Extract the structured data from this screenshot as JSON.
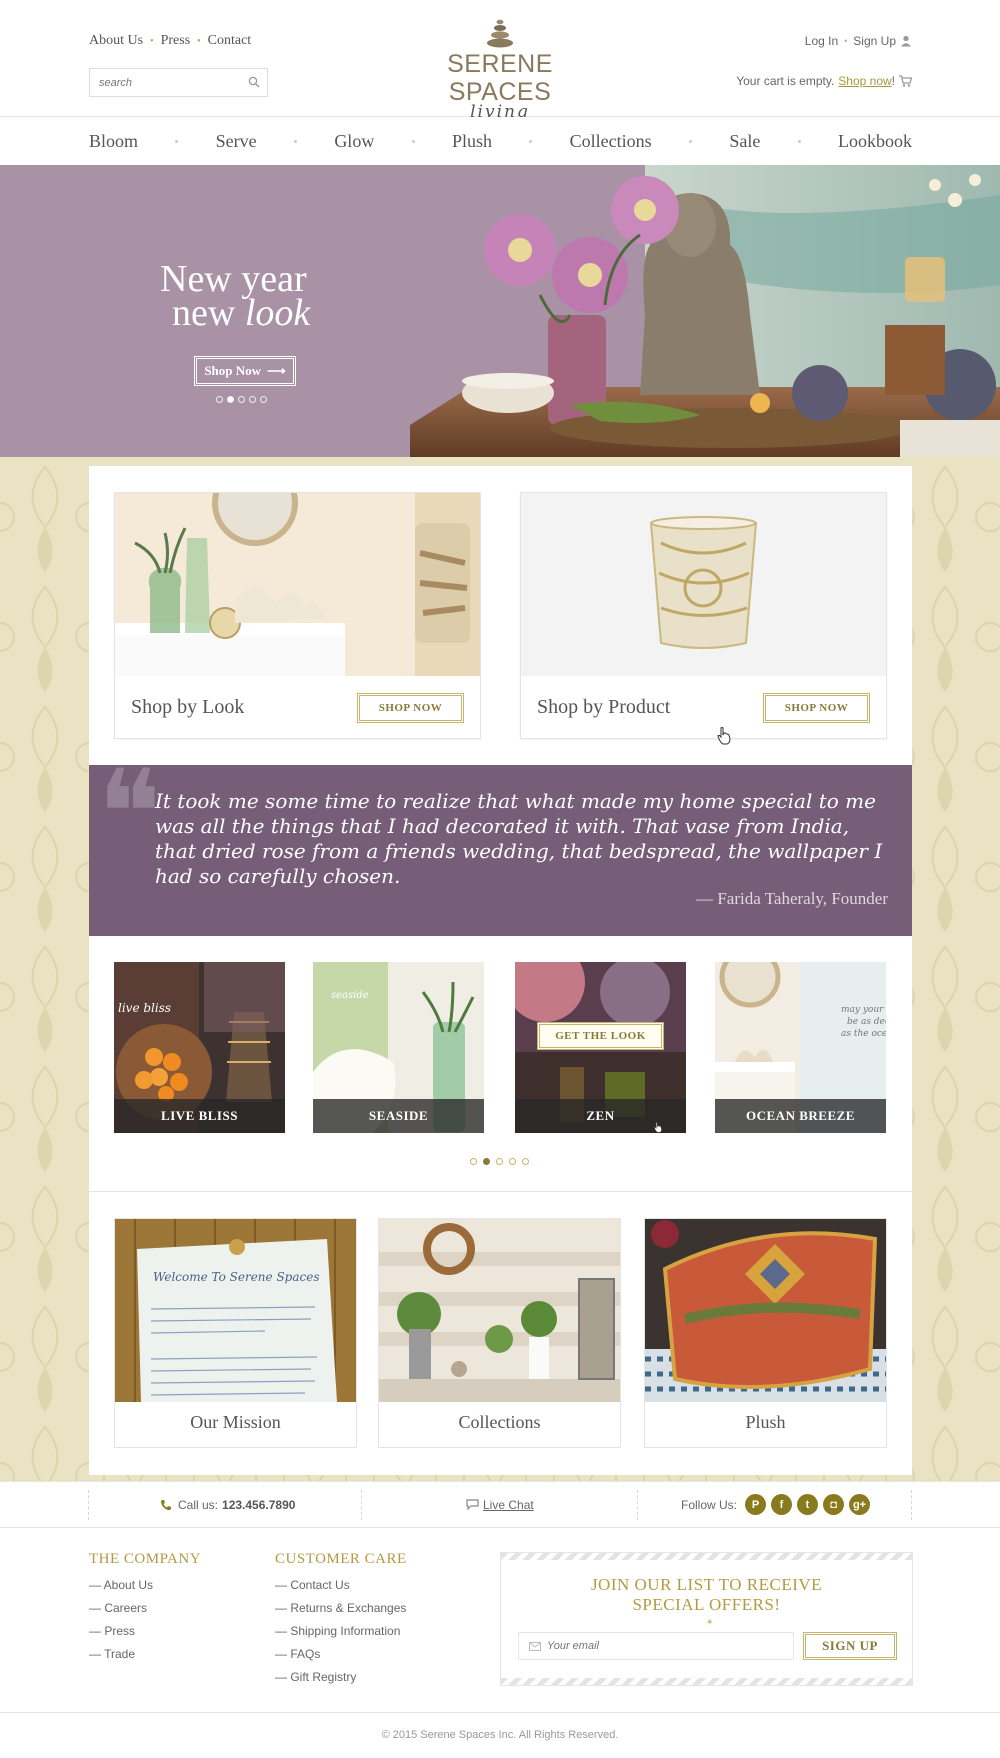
{
  "header": {
    "top_links": [
      "About Us",
      "Press",
      "Contact"
    ],
    "search_placeholder": "search",
    "logo_name": "SERENE SPACES",
    "logo_sub": "living",
    "login": "Log In",
    "signup": "Sign Up",
    "cart_text": "Your cart is empty.",
    "cart_link": "Shop now",
    "cart_end": "!"
  },
  "nav": [
    "Bloom",
    "Serve",
    "Glow",
    "Plush",
    "Collections",
    "Sale",
    "Lookbook"
  ],
  "hero": {
    "line1": "New year",
    "line2a": "new ",
    "line2b": "look",
    "button": "Shop Now",
    "slide_count": 5,
    "active_slide": 2
  },
  "shop_cards": [
    {
      "label": "Shop by Look",
      "button": "SHOP NOW"
    },
    {
      "label": "Shop by Product",
      "button": "SHOP NOW"
    }
  ],
  "quote": {
    "text": "It took me some time to realize that what made my home special to me was all the things that I had decorated it with. That vase from India, that dried rose from a friends wedding, that bedspread, the wallpaper I had so carefully chosen.",
    "author": "— Farida Taheraly, Founder"
  },
  "looks": [
    {
      "caption": "LIVE BLISS",
      "overlay": "live bliss"
    },
    {
      "caption": "SEASIDE",
      "overlay": "seaside"
    },
    {
      "caption": "ZEN",
      "button": "GET THE LOOK"
    },
    {
      "caption": "OCEAN BREEZE",
      "overlay": "may your life be as deep as the ocean"
    }
  ],
  "looks_pager": {
    "count": 5,
    "active": 2
  },
  "tiles": [
    {
      "caption": "Our Mission",
      "note_title": "Welcome To Serene Spaces"
    },
    {
      "caption": "Collections"
    },
    {
      "caption": "Plush"
    }
  ],
  "contact_bar": {
    "call_label": "Call us:",
    "phone": "123.456.7890",
    "chat": "Live Chat",
    "follow": "Follow Us:",
    "social_icons": [
      "pinterest-icon",
      "facebook-icon",
      "twitter-icon",
      "instagram-icon",
      "googleplus-icon"
    ]
  },
  "footer": {
    "company_title": "THE COMPANY",
    "company_links": [
      "— About Us",
      "— Careers",
      "— Press",
      "— Trade"
    ],
    "care_title": "CUSTOMER CARE",
    "care_links": [
      "— Contact Us",
      "— Returns & Exchanges",
      "— Shipping Information",
      "— FAQs",
      "— Gift Registry"
    ],
    "newsletter_line1": "JOIN OUR LIST TO RECEIVE",
    "newsletter_line2": "SPECIAL OFFERS!",
    "email_placeholder": "Your email",
    "signup_button": "SIGN UP",
    "copyright": "© 2015 Serene Spaces Inc. All Rights Reserved."
  },
  "colors": {
    "accent_gold": "#b39a42",
    "hero_purple": "#a992a6",
    "quote_purple": "#765d78",
    "pattern_bg": "#e9e3c4"
  }
}
